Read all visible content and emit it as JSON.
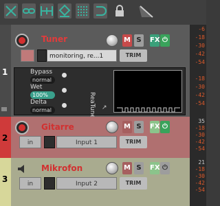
{
  "tracks": [
    {
      "number": "1",
      "name": "Tuner",
      "input": "monitoring, re...1",
      "trim": "TRIM",
      "mute": "M",
      "solo": "S",
      "fx": "FX"
    },
    {
      "number": "2",
      "name": "Gitarre",
      "input_sel": "in",
      "input": "Input 1",
      "trim": "TRIM",
      "mute": "M",
      "solo": "S",
      "fx": "FX"
    },
    {
      "number": "3",
      "name": "Mikrofon",
      "input_sel": "in",
      "input": "Input 2",
      "trim": "TRIM",
      "mute": "M",
      "solo": "S",
      "fx": "FX"
    }
  ],
  "fx_panel": {
    "title": "ReaTune",
    "params": [
      {
        "label": "Bypass",
        "value": "normal"
      },
      {
        "label": "Wet",
        "value": "100%"
      },
      {
        "label": "Delta",
        "value": "normal"
      }
    ]
  },
  "meter_ticks": {
    "t1": [
      "-6",
      "-18",
      "-30",
      "-42",
      "-54",
      "-18",
      "-30",
      "-42",
      "-54"
    ],
    "t2": [
      "35",
      "-18",
      "-30",
      "-42",
      "-54"
    ],
    "t3": [
      "21",
      "-18",
      "-30",
      "-42",
      "-54"
    ]
  },
  "colors": {
    "track2": "#cf3a3a",
    "track3": "#d7d79a"
  }
}
